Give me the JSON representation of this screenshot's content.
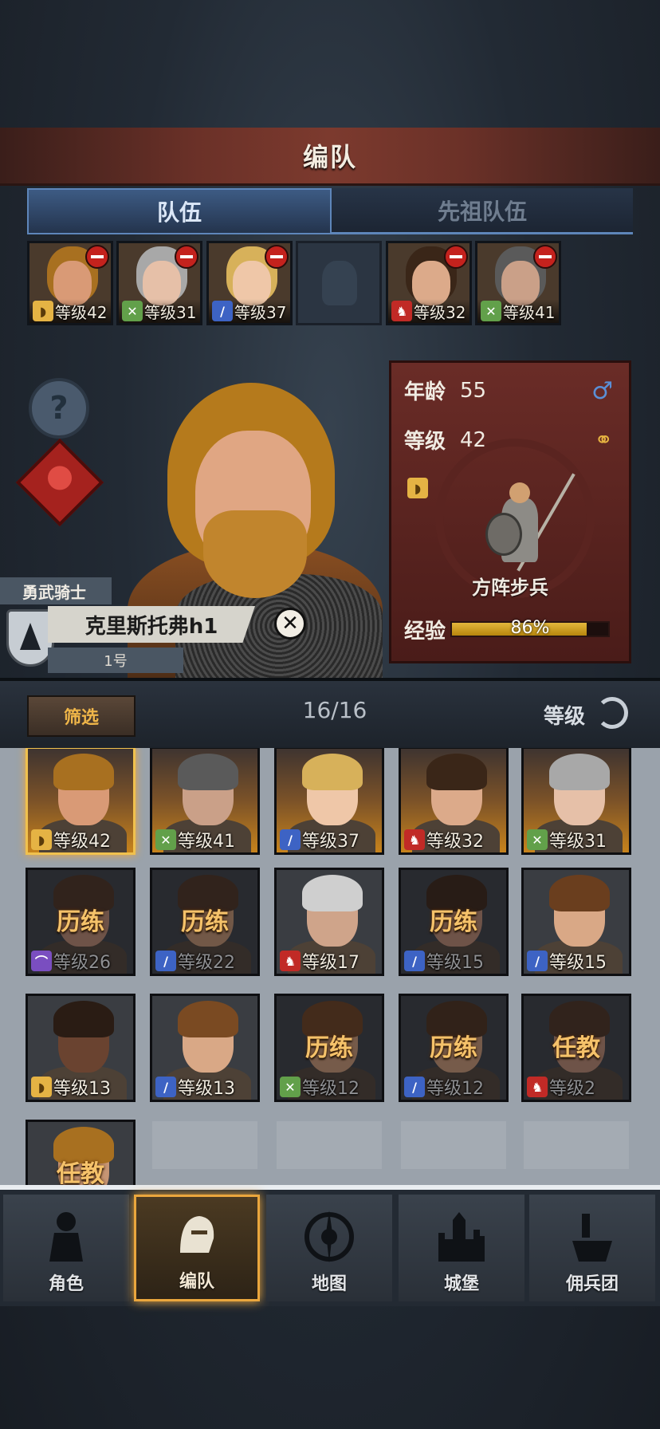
{
  "header": {
    "title": "编队"
  },
  "tabs": [
    {
      "label": "队伍",
      "active": true
    },
    {
      "label": "先祖队伍",
      "active": false
    }
  ],
  "party": [
    {
      "level": "等级42",
      "class_icon": "shield-icon",
      "hair": "#a87020",
      "skin": "#d99a76",
      "removable": true
    },
    {
      "level": "等级31",
      "class_icon": "bow-icon",
      "hair": "#a8a8a8",
      "skin": "#e6c0a8",
      "removable": true
    },
    {
      "level": "等级37",
      "class_icon": "sword-icon",
      "hair": "#d7b15a",
      "skin": "#efc7a8",
      "removable": true
    },
    {
      "level": "",
      "class_icon": "",
      "empty": true
    },
    {
      "level": "等级32",
      "class_icon": "horse-icon",
      "hair": "#3a2618",
      "skin": "#dcaa8a",
      "removable": true
    },
    {
      "level": "等级41",
      "class_icon": "bow-icon",
      "hair": "#5a5a5a",
      "skin": "#caa088",
      "removable": true
    }
  ],
  "hero": {
    "title": "勇武骑士",
    "name": "克里斯托弗h1",
    "slot": "1号",
    "stats": {
      "age_label": "年龄",
      "age": "55",
      "level_label": "等级",
      "level": "42",
      "gender_icon": "male-icon",
      "marriage_icon": "rings-icon",
      "unit_class": "方阵步兵",
      "exp_label": "经验",
      "exp_percent_text": "86%",
      "exp_fraction": 0.86
    }
  },
  "filter": {
    "button": "筛选",
    "count": "16/16",
    "sort_label": "等级"
  },
  "roster": [
    {
      "level": "等级42",
      "class": "shield",
      "status": "",
      "gold": true,
      "selected": true,
      "hair": "#a87020",
      "skin": "#d99a76"
    },
    {
      "level": "等级41",
      "class": "bow",
      "status": "",
      "gold": true,
      "hair": "#5a5a5a",
      "skin": "#caa088"
    },
    {
      "level": "等级37",
      "class": "sword",
      "status": "",
      "gold": true,
      "hair": "#d7b15a",
      "skin": "#efc7a8"
    },
    {
      "level": "等级32",
      "class": "horse",
      "status": "",
      "gold": true,
      "hair": "#3a2618",
      "skin": "#dcaa8a"
    },
    {
      "level": "等级31",
      "class": "bow",
      "status": "",
      "gold": true,
      "hair": "#a8a8a8",
      "skin": "#e6c0a8"
    },
    {
      "level": "等级26",
      "class": "staff",
      "status": "历练",
      "hair": "#4a3020",
      "skin": "#b98770",
      "faded": true
    },
    {
      "level": "等级22",
      "class": "sword",
      "status": "历练",
      "hair": "#4a3020",
      "skin": "#c0906e",
      "faded": true
    },
    {
      "level": "等级17",
      "class": "horse",
      "status": "",
      "hair": "#cfcfcf",
      "skin": "#cfa48a"
    },
    {
      "level": "等级15",
      "class": "sword",
      "status": "历练",
      "hair": "#3a2414",
      "skin": "#b98770",
      "faded": true
    },
    {
      "level": "等级15",
      "class": "sword",
      "status": "",
      "hair": "#6a3e1e",
      "skin": "#d9a886"
    },
    {
      "level": "等级13",
      "class": "shield",
      "status": "",
      "hair": "#2a1c14",
      "skin": "#6a4330"
    },
    {
      "level": "等级13",
      "class": "sword",
      "status": "",
      "hair": "#7a4a22",
      "skin": "#d9a886"
    },
    {
      "level": "等级12",
      "class": "bow",
      "status": "历练",
      "hair": "#6a3e1e",
      "skin": "#c69574",
      "faded": true
    },
    {
      "level": "等级12",
      "class": "sword",
      "status": "历练",
      "hair": "#4a2e1a",
      "skin": "#c69574",
      "faded": true
    },
    {
      "level": "等级2",
      "class": "horse",
      "status": "任教",
      "hair": "#4a3020",
      "skin": "#b98770",
      "faded": true
    },
    {
      "level": "",
      "class": "",
      "status": "任教",
      "hair": "#a87020",
      "skin": "#c69574",
      "partial": true
    }
  ],
  "nav": [
    {
      "label": "角色",
      "icon": "knight-icon",
      "active": false
    },
    {
      "label": "编队",
      "icon": "helmet-icon",
      "active": true
    },
    {
      "label": "地图",
      "icon": "compass-icon",
      "active": false
    },
    {
      "label": "城堡",
      "icon": "castle-icon",
      "active": false
    },
    {
      "label": "佣兵团",
      "icon": "mercenary-icon",
      "active": false
    }
  ],
  "colors": {
    "accent_gold": "#eaa63d",
    "tab_blue": "#5e86ba",
    "banner_red": "#6a2c27"
  }
}
